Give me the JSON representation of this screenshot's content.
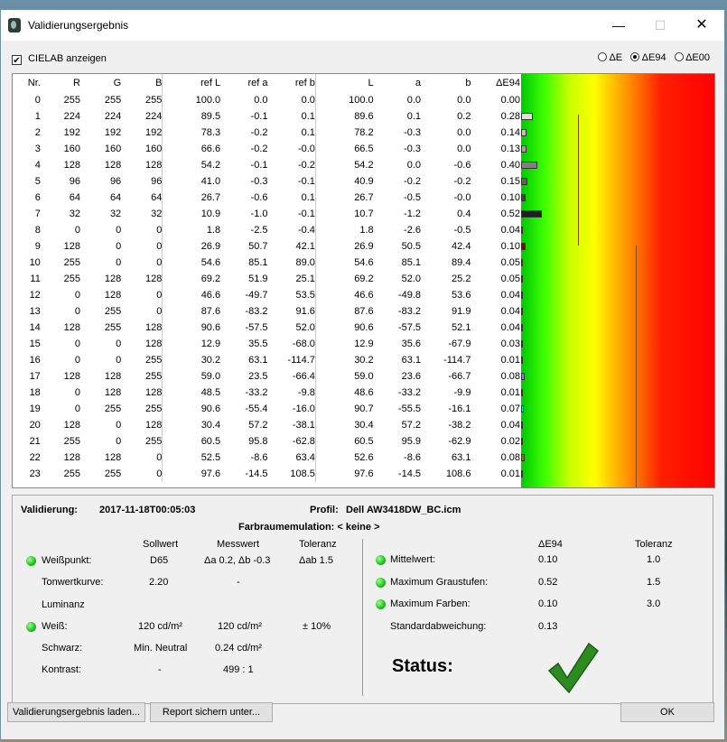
{
  "window": {
    "title": "Validierungsergebnis"
  },
  "controls": {
    "show_cielab_label": "CIELAB anzeigen",
    "radio_options": [
      {
        "label": "ΔE",
        "selected": false
      },
      {
        "label": "ΔE94",
        "selected": true
      },
      {
        "label": "ΔE00",
        "selected": false
      }
    ]
  },
  "table": {
    "headers": [
      "Nr.",
      "R",
      "G",
      "B",
      "ref L",
      "ref a",
      "ref b",
      "L",
      "a",
      "b",
      "ΔE94"
    ],
    "rows": [
      [
        "0",
        "255",
        "255",
        "255",
        "100.0",
        "0.0",
        "0.0",
        "100.0",
        "0.0",
        "0.0",
        "0.00"
      ],
      [
        "1",
        "224",
        "224",
        "224",
        "89.5",
        "-0.1",
        "0.1",
        "89.6",
        "0.1",
        "0.2",
        "0.28"
      ],
      [
        "2",
        "192",
        "192",
        "192",
        "78.3",
        "-0.2",
        "0.1",
        "78.2",
        "-0.3",
        "0.0",
        "0.14"
      ],
      [
        "3",
        "160",
        "160",
        "160",
        "66.6",
        "-0.2",
        "-0.0",
        "66.5",
        "-0.3",
        "0.0",
        "0.13"
      ],
      [
        "4",
        "128",
        "128",
        "128",
        "54.2",
        "-0.1",
        "-0.2",
        "54.2",
        "0.0",
        "-0.6",
        "0.40"
      ],
      [
        "5",
        "96",
        "96",
        "96",
        "41.0",
        "-0.3",
        "-0.1",
        "40.9",
        "-0.2",
        "-0.2",
        "0.15"
      ],
      [
        "6",
        "64",
        "64",
        "64",
        "26.7",
        "-0.6",
        "0.1",
        "26.7",
        "-0.5",
        "-0.0",
        "0.10"
      ],
      [
        "7",
        "32",
        "32",
        "32",
        "10.9",
        "-1.0",
        "-0.1",
        "10.7",
        "-1.2",
        "0.4",
        "0.52"
      ],
      [
        "8",
        "0",
        "0",
        "0",
        "1.8",
        "-2.5",
        "-0.4",
        "1.8",
        "-2.6",
        "-0.5",
        "0.04"
      ],
      [
        "9",
        "128",
        "0",
        "0",
        "26.9",
        "50.7",
        "42.1",
        "26.9",
        "50.5",
        "42.4",
        "0.10"
      ],
      [
        "10",
        "255",
        "0",
        "0",
        "54.6",
        "85.1",
        "89.0",
        "54.6",
        "85.1",
        "89.4",
        "0.05"
      ],
      [
        "11",
        "255",
        "128",
        "128",
        "69.2",
        "51.9",
        "25.1",
        "69.2",
        "52.0",
        "25.2",
        "0.05"
      ],
      [
        "12",
        "0",
        "128",
        "0",
        "46.6",
        "-49.7",
        "53.5",
        "46.6",
        "-49.8",
        "53.6",
        "0.04"
      ],
      [
        "13",
        "0",
        "255",
        "0",
        "87.6",
        "-83.2",
        "91.6",
        "87.6",
        "-83.2",
        "91.9",
        "0.04"
      ],
      [
        "14",
        "128",
        "255",
        "128",
        "90.6",
        "-57.5",
        "52.0",
        "90.6",
        "-57.5",
        "52.1",
        "0.04"
      ],
      [
        "15",
        "0",
        "0",
        "128",
        "12.9",
        "35.5",
        "-68.0",
        "12.9",
        "35.6",
        "-67.9",
        "0.03"
      ],
      [
        "16",
        "0",
        "0",
        "255",
        "30.2",
        "63.1",
        "-114.7",
        "30.2",
        "63.1",
        "-114.7",
        "0.01"
      ],
      [
        "17",
        "128",
        "128",
        "255",
        "59.0",
        "23.5",
        "-66.4",
        "59.0",
        "23.6",
        "-66.7",
        "0.08"
      ],
      [
        "18",
        "0",
        "128",
        "128",
        "48.5",
        "-33.2",
        "-9.8",
        "48.6",
        "-33.2",
        "-9.9",
        "0.01"
      ],
      [
        "19",
        "0",
        "255",
        "255",
        "90.6",
        "-55.4",
        "-16.0",
        "90.7",
        "-55.5",
        "-16.1",
        "0.07"
      ],
      [
        "20",
        "128",
        "0",
        "128",
        "30.4",
        "57.2",
        "-38.1",
        "30.4",
        "57.2",
        "-38.2",
        "0.04"
      ],
      [
        "21",
        "255",
        "0",
        "255",
        "60.5",
        "95.8",
        "-62.8",
        "60.5",
        "95.9",
        "-62.9",
        "0.02"
      ],
      [
        "22",
        "128",
        "128",
        "0",
        "52.5",
        "-8.6",
        "63.4",
        "52.6",
        "-8.6",
        "63.1",
        "0.08"
      ],
      [
        "23",
        "255",
        "255",
        "0",
        "97.6",
        "-14.5",
        "108.5",
        "97.6",
        "-14.5",
        "108.6",
        "0.01"
      ]
    ],
    "bar_colors": [
      "#ffffff",
      "#e0e0e0",
      "#c0c0c0",
      "#a0a0a0",
      "#808080",
      "#606060",
      "#404040",
      "#202020",
      "#000000",
      "#800000",
      "#ff0000",
      "#ff8080",
      "#008000",
      "#00ff00",
      "#80ff80",
      "#000080",
      "#0000ff",
      "#8080ff",
      "#008080",
      "#00ffff",
      "#800080",
      "#ff00ff",
      "#808000",
      "#ffff00"
    ]
  },
  "summary": {
    "validation_label": "Validierung:",
    "validation_date": "2017-11-18T00:05:03",
    "profile_label": "Profil:",
    "profile_name": "Dell AW3418DW_BC.icm",
    "gamut_emulation": "Farbraumemulation: < keine >",
    "col_headers": {
      "target": "Sollwert",
      "measured": "Messwert",
      "tolerance": "Toleranz"
    },
    "rows": {
      "whitepoint": {
        "label": "Weißpunkt:",
        "target": "D65",
        "measured": "Δa 0.2, Δb -0.3",
        "tolerance": "Δab 1.5"
      },
      "tone_curve": {
        "label": "Tonwertkurve:",
        "target": "2.20",
        "measured": "-"
      },
      "luminance": {
        "label": "Luminanz"
      },
      "white": {
        "label": "Weiß:",
        "target": "120 cd/m²",
        "measured": "120 cd/m²",
        "tolerance": "± 10%"
      },
      "black": {
        "label": "Schwarz:",
        "target": "Min. Neutral",
        "measured": "0.24 cd/m²"
      },
      "contrast": {
        "label": "Kontrast:",
        "target": "-",
        "measured": "499 : 1"
      }
    },
    "right_headers": {
      "delta": "ΔE94",
      "tolerance": "Toleranz"
    },
    "right_rows": {
      "mean": {
        "label": "Mittelwert:",
        "value": "0.10",
        "tolerance": "1.0"
      },
      "max_gray": {
        "label": "Maximum Graustufen:",
        "value": "0.52",
        "tolerance": "1.5"
      },
      "max_color": {
        "label": "Maximum Farben:",
        "value": "0.10",
        "tolerance": "3.0"
      },
      "std_dev": {
        "label": "Standardabweichung:",
        "value": "0.13"
      }
    },
    "status_label": "Status:",
    "status_ok": true,
    "led_color": "#1fbf1f"
  },
  "buttons": {
    "load": "Validierungsergebnis laden...",
    "save": "Report sichern unter...",
    "ok": "OK"
  }
}
